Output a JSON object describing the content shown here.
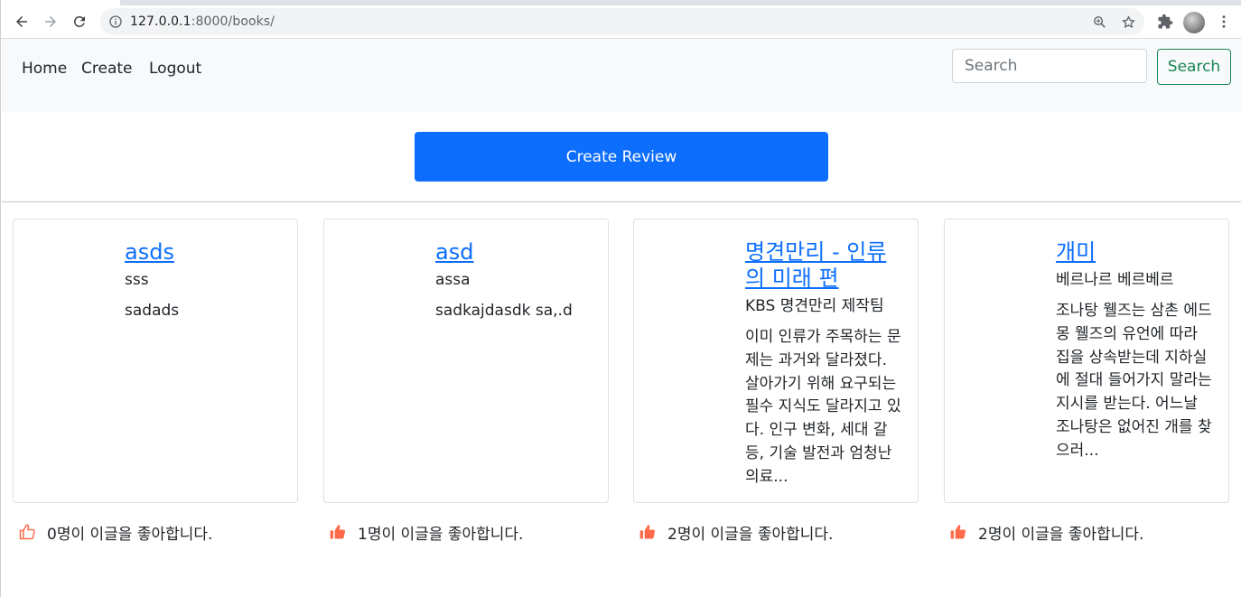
{
  "browser": {
    "url_host": "127.0.0.1",
    "url_rest": ":8000/books/",
    "icons": [
      "back-icon",
      "forward-icon",
      "reload-icon",
      "info-icon",
      "zoom-icon",
      "star-icon",
      "extensions-icon",
      "profile-avatar",
      "menu-icon"
    ]
  },
  "navbar": {
    "home": "Home",
    "create": "Create",
    "logout": "Logout",
    "search_placeholder": "Search",
    "search_button": "Search"
  },
  "create_review_label": "Create Review",
  "accent_color": "#0d6efd",
  "like_color": "#ff6b4a",
  "cards": [
    {
      "title": "asds",
      "subtitle": "sss",
      "text": "sadads",
      "likes": "0명이 이글을 좋아합니다.",
      "liked": false
    },
    {
      "title": "asd",
      "subtitle": "assa",
      "text": "sadkajdasdk sa,.d",
      "likes": "1명이 이글을 좋아합니다.",
      "liked": true
    },
    {
      "title": "명견만리 - 인류의 미래 편",
      "subtitle": "KBS 명견만리 제작팀",
      "text": "이미 인류가 주목하는 문제는 과거와 달라졌다. 살아가기 위해 요구되는 필수 지식도 달라지고 있다. 인구 변화, 세대 갈등, 기술 발전과 엄청난 의료...",
      "likes": "2명이 이글을 좋아합니다.",
      "liked": true
    },
    {
      "title": "개미",
      "subtitle": "베르나르 베르베르",
      "text": "조나탕 웰즈는 삼촌 에드몽 웰즈의 유언에 따라 집을 상속받는데 지하실에 절대 들어가지 말라는 지시를 받는다. 어느날 조나탕은 없어진 개를 찾으러...",
      "likes": "2명이 이글을 좋아합니다.",
      "liked": true
    }
  ]
}
